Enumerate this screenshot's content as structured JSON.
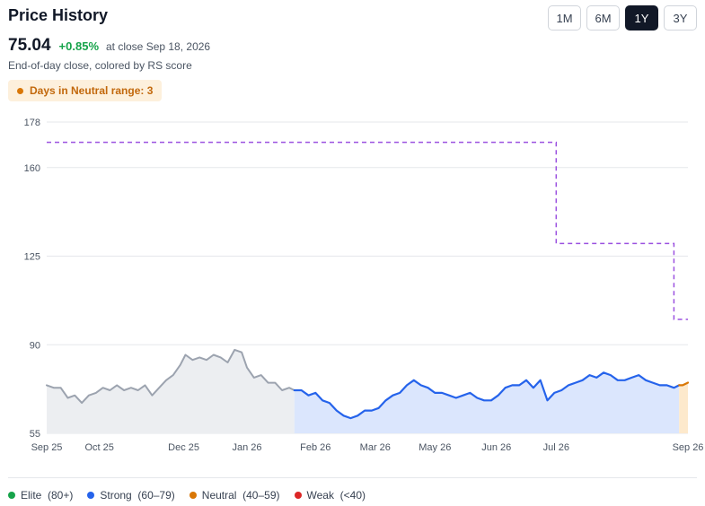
{
  "header": {
    "title": "Price History",
    "price": "75.04",
    "change": "+0.85%",
    "as_of": "at close Sep 18, 2026",
    "subtitle": "End-of-day close, colored by RS score",
    "badge": "Days in Neutral range: 3"
  },
  "range_buttons": [
    {
      "label": "1M",
      "active": false
    },
    {
      "label": "6M",
      "active": false
    },
    {
      "label": "1Y",
      "active": true
    },
    {
      "label": "3Y",
      "active": false
    }
  ],
  "legend": [
    {
      "label": "Elite",
      "range": "(80+)",
      "color": "#16a34a"
    },
    {
      "label": "Strong",
      "range": "(60–79)",
      "color": "#2563eb"
    },
    {
      "label": "Neutral",
      "range": "(40–59)",
      "color": "#d97706"
    },
    {
      "label": "Weak",
      "range": "(<40)",
      "color": "#dc2626"
    }
  ],
  "chart_data": {
    "type": "line",
    "xlim": [
      "2025-09-18",
      "2026-09-18"
    ],
    "ylim": [
      55,
      178
    ],
    "y_ticks": [
      55,
      90,
      125,
      160,
      178
    ],
    "x_ticks": [
      {
        "label": "Sep 25",
        "date": "2025-09-18"
      },
      {
        "label": "Oct 25",
        "date": "2025-10-18"
      },
      {
        "label": "Dec 25",
        "date": "2025-12-05"
      },
      {
        "label": "Jan 26",
        "date": "2026-01-10"
      },
      {
        "label": "Feb 26",
        "date": "2026-02-18"
      },
      {
        "label": "Mar 26",
        "date": "2026-03-24"
      },
      {
        "label": "May 26",
        "date": "2026-04-27"
      },
      {
        "label": "Jun 26",
        "date": "2026-06-01"
      },
      {
        "label": "Jul 26",
        "date": "2026-07-05"
      },
      {
        "label": "Sep 26",
        "date": "2026-09-18"
      }
    ],
    "colors": {
      "gray": "#9ca3af",
      "gray_fill": "#eceef1",
      "strong": "#2563eb",
      "strong_fill": "#dbe6fd",
      "neutral": "#d97706",
      "neutral_fill": "#fde9cc",
      "threshold": "#9b51e0"
    },
    "series": [
      {
        "rs_band": "none",
        "points": [
          [
            "2025-09-18",
            74
          ],
          [
            "2025-09-22",
            73
          ],
          [
            "2025-09-26",
            73
          ],
          [
            "2025-09-30",
            69
          ],
          [
            "2025-10-04",
            70
          ],
          [
            "2025-10-08",
            67
          ],
          [
            "2025-10-12",
            70
          ],
          [
            "2025-10-16",
            71
          ],
          [
            "2025-10-20",
            73
          ],
          [
            "2025-10-24",
            72
          ],
          [
            "2025-10-28",
            74
          ],
          [
            "2025-11-01",
            72
          ],
          [
            "2025-11-05",
            73
          ],
          [
            "2025-11-09",
            72
          ],
          [
            "2025-11-13",
            74
          ],
          [
            "2025-11-17",
            70
          ],
          [
            "2025-11-21",
            73
          ],
          [
            "2025-11-25",
            76
          ],
          [
            "2025-11-29",
            78
          ],
          [
            "2025-12-03",
            82
          ],
          [
            "2025-12-06",
            86
          ],
          [
            "2025-12-10",
            84
          ],
          [
            "2025-12-14",
            85
          ],
          [
            "2025-12-18",
            84
          ],
          [
            "2025-12-22",
            86
          ],
          [
            "2025-12-26",
            85
          ],
          [
            "2025-12-30",
            83
          ],
          [
            "2026-01-03",
            88
          ],
          [
            "2026-01-07",
            87
          ],
          [
            "2026-01-10",
            81
          ],
          [
            "2026-01-14",
            77
          ],
          [
            "2026-01-18",
            78
          ],
          [
            "2026-01-22",
            75
          ],
          [
            "2026-01-26",
            75
          ],
          [
            "2026-01-30",
            72
          ],
          [
            "2026-02-03",
            73
          ],
          [
            "2026-02-06",
            72
          ]
        ]
      },
      {
        "rs_band": "strong",
        "points": [
          [
            "2026-02-06",
            72
          ],
          [
            "2026-02-10",
            72
          ],
          [
            "2026-02-14",
            70
          ],
          [
            "2026-02-18",
            71
          ],
          [
            "2026-02-22",
            68
          ],
          [
            "2026-02-26",
            67
          ],
          [
            "2026-03-02",
            64
          ],
          [
            "2026-03-06",
            62
          ],
          [
            "2026-03-10",
            61
          ],
          [
            "2026-03-14",
            62
          ],
          [
            "2026-03-18",
            64
          ],
          [
            "2026-03-22",
            64
          ],
          [
            "2026-03-26",
            65
          ],
          [
            "2026-03-30",
            68
          ],
          [
            "2026-04-03",
            70
          ],
          [
            "2026-04-07",
            71
          ],
          [
            "2026-04-11",
            74
          ],
          [
            "2026-04-15",
            76
          ],
          [
            "2026-04-19",
            74
          ],
          [
            "2026-04-23",
            73
          ],
          [
            "2026-04-27",
            71
          ],
          [
            "2026-05-01",
            71
          ],
          [
            "2026-05-05",
            70
          ],
          [
            "2026-05-09",
            69
          ],
          [
            "2026-05-13",
            70
          ],
          [
            "2026-05-17",
            71
          ],
          [
            "2026-05-21",
            69
          ],
          [
            "2026-05-25",
            68
          ],
          [
            "2026-05-29",
            68
          ],
          [
            "2026-06-02",
            70
          ],
          [
            "2026-06-06",
            73
          ],
          [
            "2026-06-10",
            74
          ],
          [
            "2026-06-14",
            74
          ],
          [
            "2026-06-18",
            76
          ],
          [
            "2026-06-22",
            73
          ],
          [
            "2026-06-26",
            76
          ],
          [
            "2026-06-30",
            68
          ],
          [
            "2026-07-04",
            71
          ],
          [
            "2026-07-08",
            72
          ],
          [
            "2026-07-12",
            74
          ],
          [
            "2026-07-16",
            75
          ],
          [
            "2026-07-20",
            76
          ],
          [
            "2026-07-24",
            78
          ],
          [
            "2026-07-28",
            77
          ],
          [
            "2026-08-01",
            79
          ],
          [
            "2026-08-05",
            78
          ],
          [
            "2026-08-09",
            76
          ],
          [
            "2026-08-13",
            76
          ],
          [
            "2026-08-17",
            77
          ],
          [
            "2026-08-21",
            78
          ],
          [
            "2026-08-25",
            76
          ],
          [
            "2026-08-29",
            75
          ],
          [
            "2026-09-02",
            74
          ],
          [
            "2026-09-06",
            74
          ],
          [
            "2026-09-10",
            73
          ],
          [
            "2026-09-13",
            74
          ]
        ]
      },
      {
        "rs_band": "neutral",
        "points": [
          [
            "2026-09-13",
            74
          ],
          [
            "2026-09-15",
            74
          ],
          [
            "2026-09-18",
            75.04
          ]
        ]
      }
    ],
    "threshold_line": {
      "style": "dashed",
      "points": [
        [
          "2025-09-18",
          170
        ],
        [
          "2026-07-05",
          170
        ],
        [
          "2026-07-05",
          130
        ],
        [
          "2026-09-10",
          130
        ],
        [
          "2026-09-10",
          100
        ],
        [
          "2026-09-18",
          100
        ]
      ]
    }
  }
}
